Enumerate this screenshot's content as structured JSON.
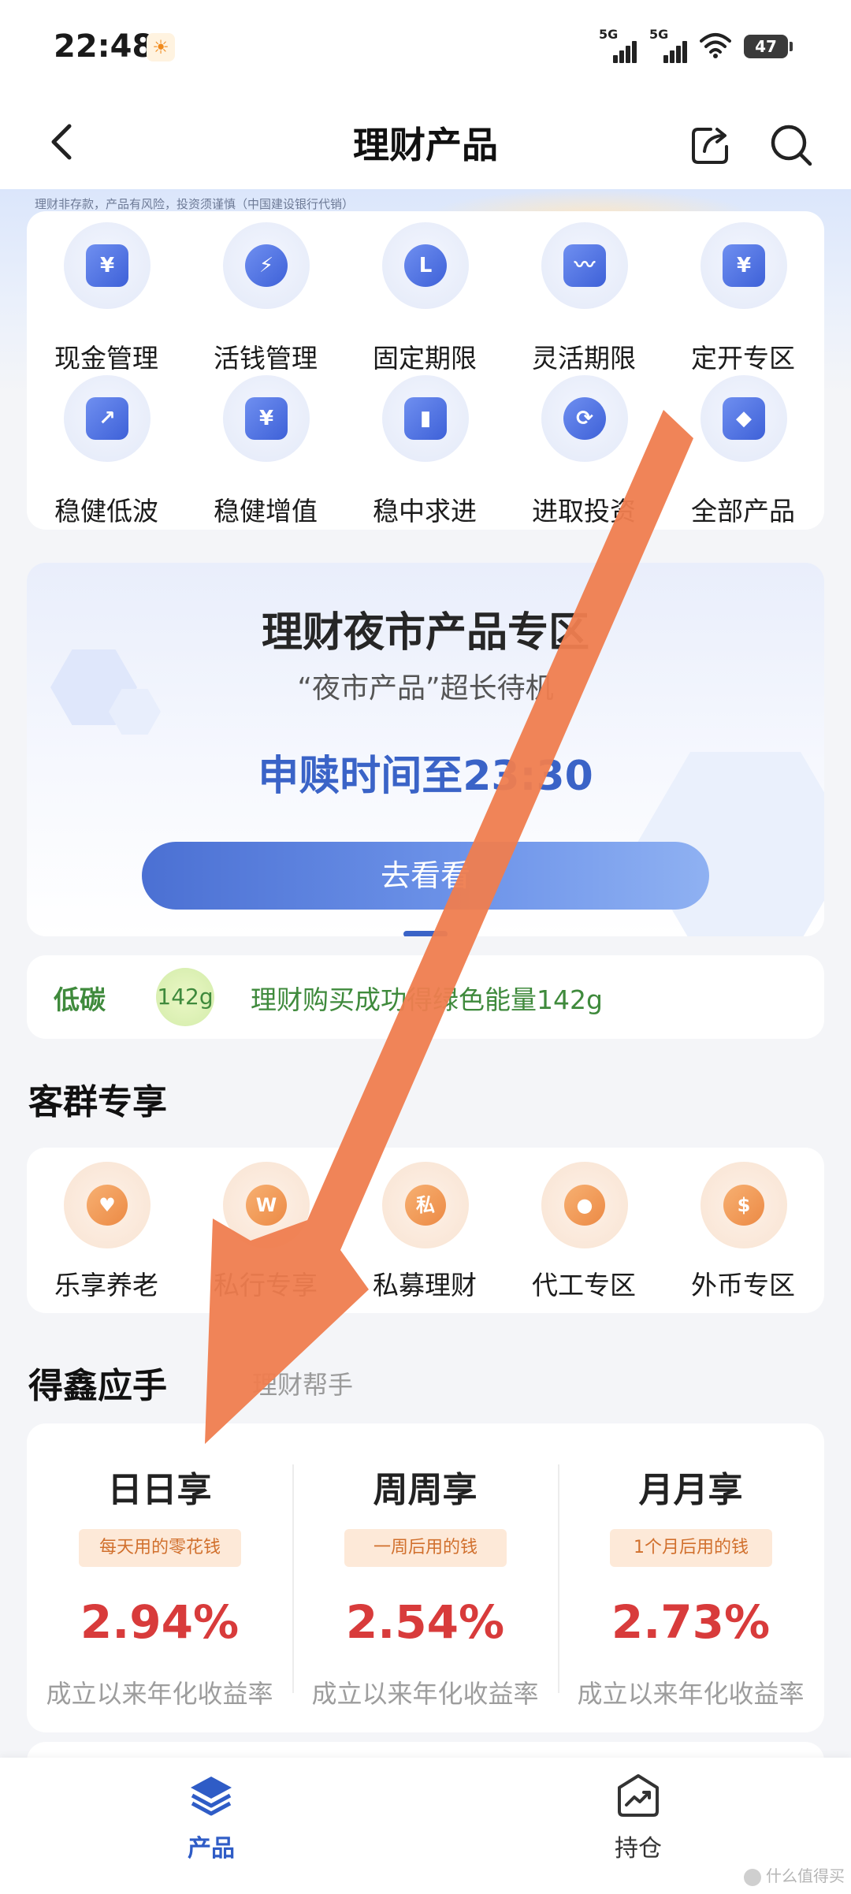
{
  "status_bar": {
    "time": "22:48",
    "signal1_label": "5G",
    "signal2_label": "5G",
    "battery": "47"
  },
  "nav": {
    "title": "理财产品"
  },
  "disclaimer": "理财非存款，产品有风险，投资须谨慎（中国建设银行代销）",
  "categories": [
    {
      "label": "现金管理",
      "icon": "cash-icon",
      "glyph": "¥"
    },
    {
      "label": "活钱管理",
      "icon": "shield-bolt-icon",
      "glyph": "⚡"
    },
    {
      "label": "固定期限",
      "icon": "clock-icon",
      "glyph": "L"
    },
    {
      "label": "灵活期限",
      "icon": "chart-line-icon",
      "glyph": "〰"
    },
    {
      "label": "定开专区",
      "icon": "calendar-icon",
      "glyph": "¥"
    },
    {
      "label": "稳健低波",
      "icon": "trend-icon",
      "glyph": "↗"
    },
    {
      "label": "稳健增值",
      "icon": "house-icon",
      "glyph": "¥"
    },
    {
      "label": "稳中求进",
      "icon": "bar-chart-icon",
      "glyph": "▮"
    },
    {
      "label": "进取投资",
      "icon": "coin-cycle-icon",
      "glyph": "⟳"
    },
    {
      "label": "全部产品",
      "icon": "grid-icon",
      "glyph": "◆"
    }
  ],
  "banner": {
    "title": "理财夜市产品专区",
    "subtitle": "“夜市产品”超长待机",
    "time_text": "申赎时间至23:30",
    "button": "去看看"
  },
  "carbon": {
    "label": "低碳",
    "badge": "142g",
    "text": "理财购买成功得绿色能量142g"
  },
  "customer_section": {
    "title": "客群专享",
    "items": [
      {
        "label": "乐享养老",
        "icon": "elder-icon",
        "glyph": "♥"
      },
      {
        "label": "私行专享",
        "icon": "crown-icon",
        "glyph": "W"
      },
      {
        "label": "私募理财",
        "icon": "money-bag-icon",
        "glyph": "私"
      },
      {
        "label": "代工专区",
        "icon": "worker-icon",
        "glyph": "●"
      },
      {
        "label": "外币专区",
        "icon": "dollar-icon",
        "glyph": "$"
      }
    ]
  },
  "yield_section": {
    "title": "得鑫应手",
    "hint": "理财帮手",
    "products": [
      {
        "name": "日日享",
        "tag": "每天用的零花钱",
        "rate": "2.94%",
        "desc": "成立以来年化收益率"
      },
      {
        "name": "周周享",
        "tag": "一周后用的钱",
        "rate": "2.54%",
        "desc": "成立以来年化收益率"
      },
      {
        "name": "月月享",
        "tag": "1个月后用的钱",
        "rate": "2.73%",
        "desc": "成立以来年化收益率"
      }
    ]
  },
  "tabbar": {
    "products": "产品",
    "holdings": "持仓"
  },
  "watermark": "什么值得买",
  "colors": {
    "accent_blue": "#2f5cc6",
    "rate_red": "#d83b3b",
    "carbon_green": "#3f8a3c",
    "arrow_orange": "#ef7d4f"
  }
}
